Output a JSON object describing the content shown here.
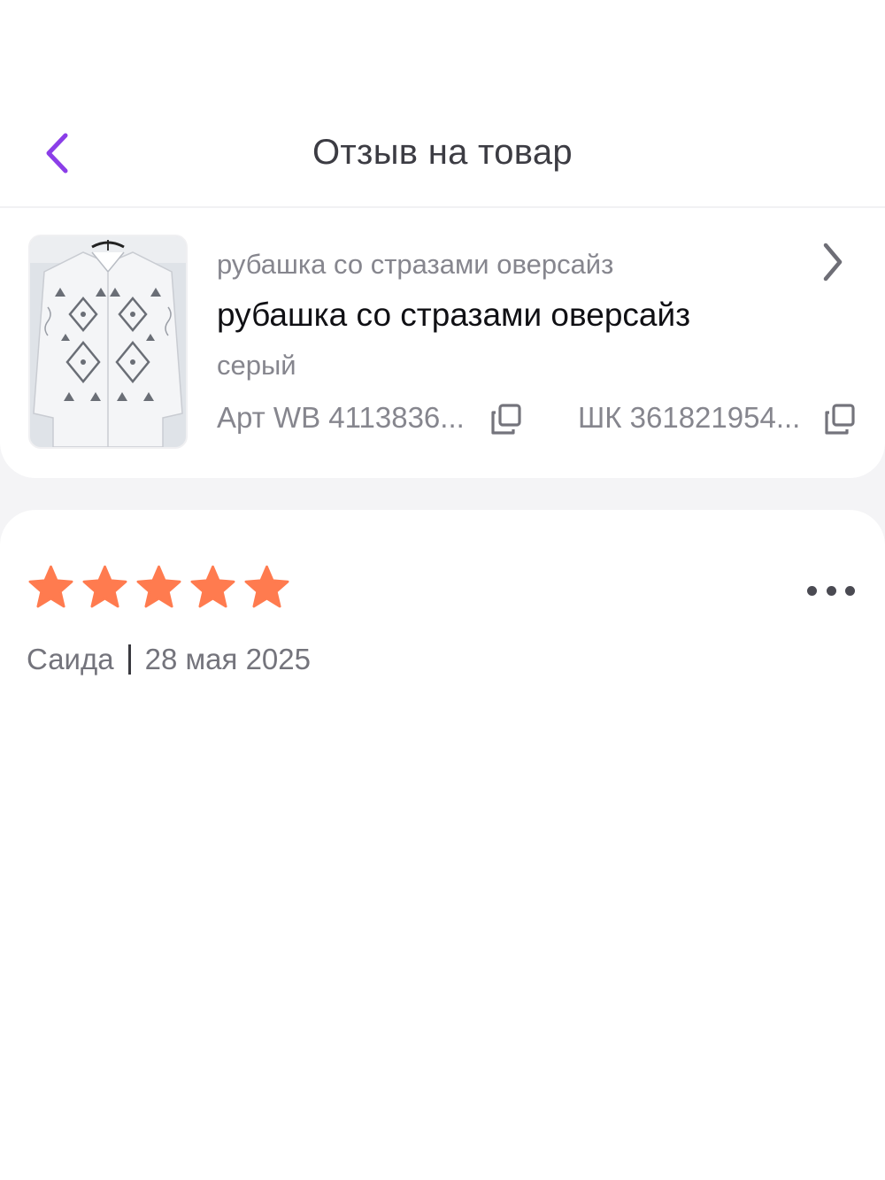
{
  "header": {
    "title": "Отзыв на товар",
    "back_icon": "chevron-left-icon",
    "accent_color": "#8b3ee8"
  },
  "product": {
    "subtitle": "рубашка со стразами оверсайз",
    "name": "рубашка со стразами оверсайз",
    "color": "серый",
    "article": "Арт WB 4113836...",
    "barcode": "ШК 361821954...",
    "image_icon": "shirt-photo",
    "copy_icon": "copy-icon",
    "open_icon": "chevron-right-icon"
  },
  "review": {
    "rating": 5,
    "rating_max": 5,
    "star_color": "#ff7b4f",
    "author": "Саида",
    "date": "28 мая 2025",
    "more_icon": "more-dots-icon"
  }
}
